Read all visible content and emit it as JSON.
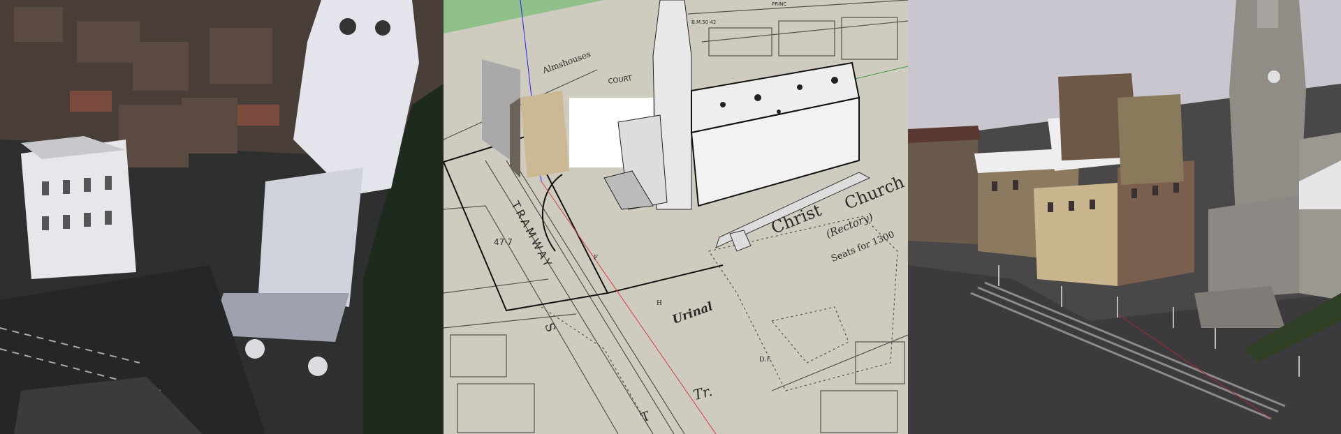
{
  "panels": [
    {
      "label": "aerial-photo"
    },
    {
      "label": "sketchup-model-on-map"
    },
    {
      "label": "rendered-3d-model"
    }
  ],
  "map_labels": {
    "almshouses": "Almshouses",
    "court": "COURT",
    "bench_mark": "B.M.50·42",
    "princ": "PRINC",
    "tramway": "TRAMWAY",
    "spot_height": "47·7",
    "christ": "Christ",
    "church": "Church",
    "rectory": "(Rectory)",
    "seats": "Seats for 1300",
    "urinal": "Urinal",
    "df": "D.F",
    "tr": "Tr.",
    "s": "S",
    "t": "T",
    "h": "H",
    "f": "F"
  },
  "colors": {
    "map_paper": "#cfcbbf",
    "sky_green": "#8fc08a",
    "render_sky": "#c9c6cf",
    "ground": "#4a4749"
  }
}
